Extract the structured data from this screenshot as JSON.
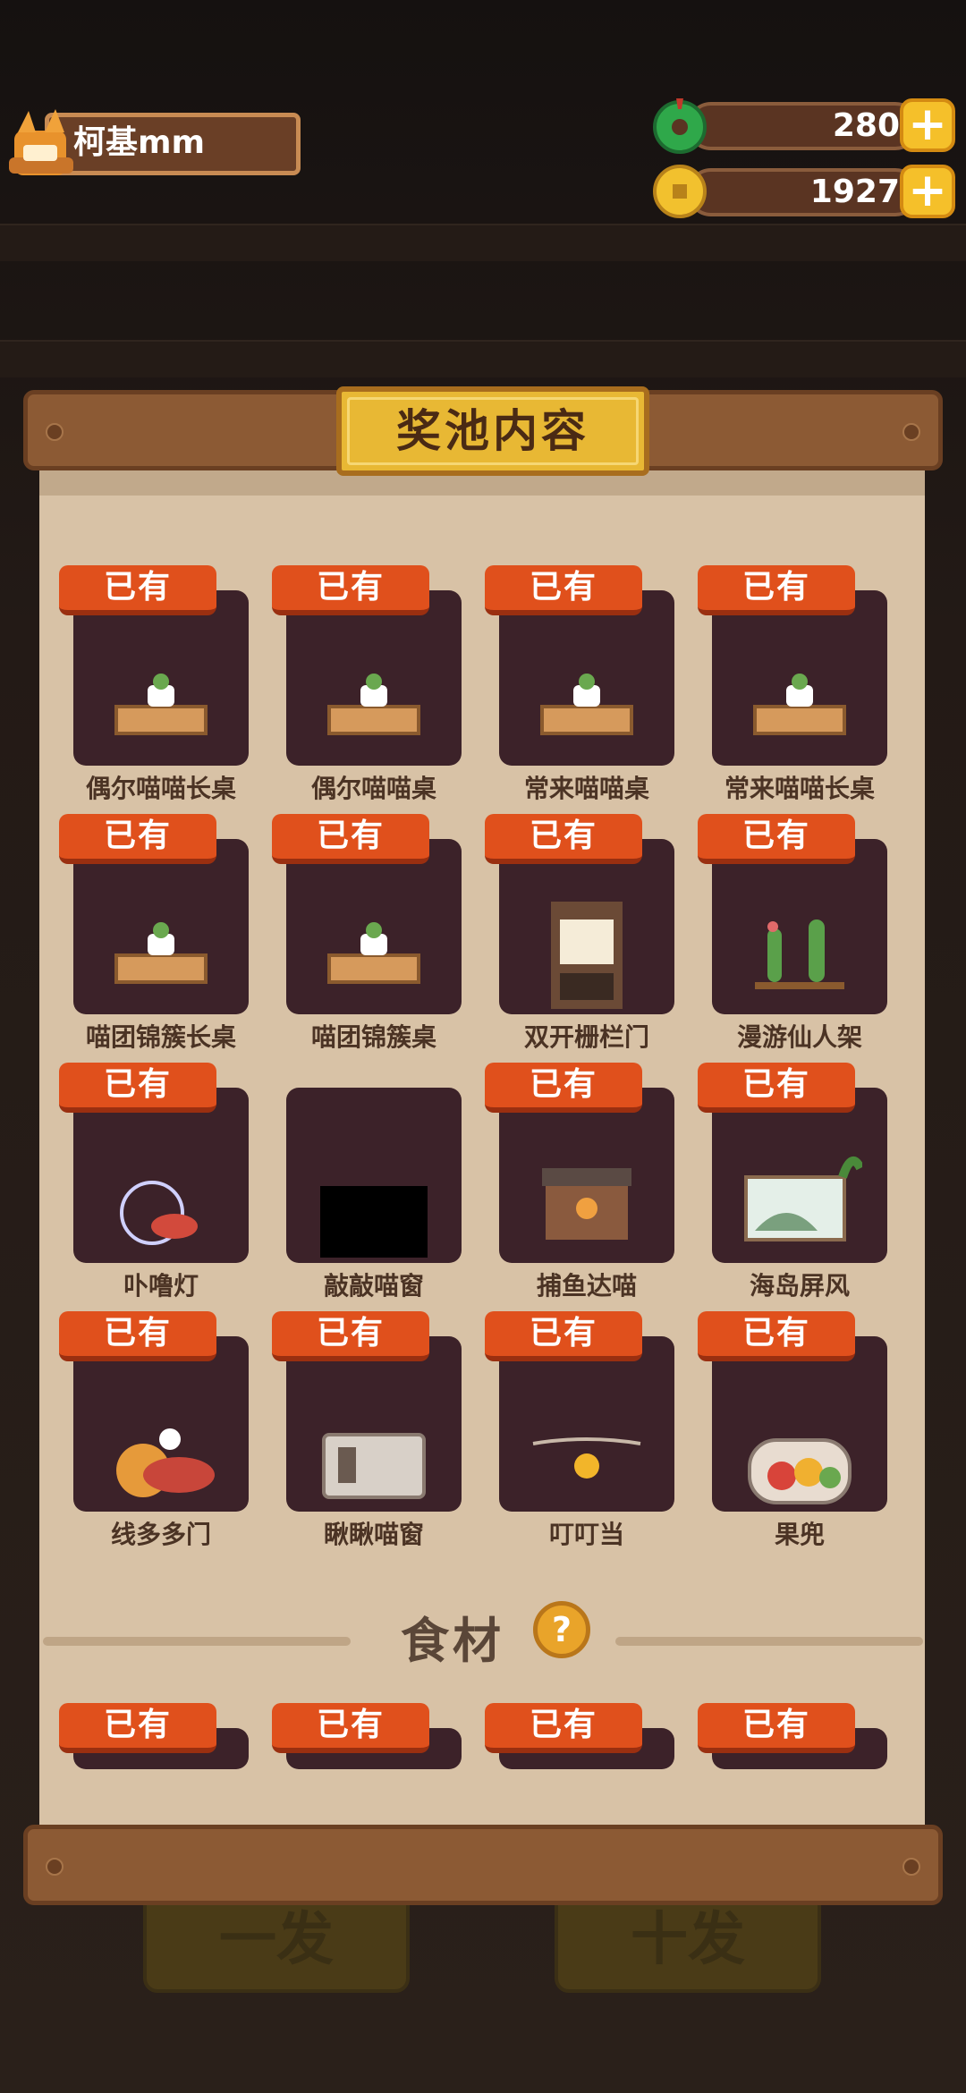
{
  "player": {
    "name": "柯基mm"
  },
  "currencies": {
    "jade": {
      "value": "280",
      "plus": "+"
    },
    "coin": {
      "value": "1927",
      "plus": "+"
    }
  },
  "modal": {
    "title": "奖池内容",
    "owned_tag": "已有",
    "items": [
      {
        "label": "偶尔喵喵长桌",
        "owned": true,
        "icon": "table-icon"
      },
      {
        "label": "偶尔喵喵桌",
        "owned": true,
        "icon": "table-icon"
      },
      {
        "label": "常来喵喵桌",
        "owned": true,
        "icon": "table-icon"
      },
      {
        "label": "常来喵喵长桌",
        "owned": true,
        "icon": "table-icon"
      },
      {
        "label": "喵团锦簇长桌",
        "owned": true,
        "icon": "table-icon"
      },
      {
        "label": "喵团锦簇桌",
        "owned": true,
        "icon": "table-icon"
      },
      {
        "label": "双开栅栏门",
        "owned": true,
        "icon": "door-icon"
      },
      {
        "label": "漫游仙人架",
        "owned": true,
        "icon": "cactus-shelf-icon"
      },
      {
        "label": "卟噜灯",
        "owned": true,
        "icon": "lamp-icon"
      },
      {
        "label": "敲敲喵窗",
        "owned": false,
        "icon": "locked-icon"
      },
      {
        "label": "捕鱼达喵",
        "owned": true,
        "icon": "stall-icon"
      },
      {
        "label": "海岛屏风",
        "owned": true,
        "icon": "screen-icon"
      },
      {
        "label": "线多多门",
        "owned": true,
        "icon": "yarn-icon"
      },
      {
        "label": "瞅瞅喵窗",
        "owned": true,
        "icon": "window-icon"
      },
      {
        "label": "叮叮当",
        "owned": true,
        "icon": "bell-icon"
      },
      {
        "label": "果兜",
        "owned": true,
        "icon": "fruit-icon"
      }
    ],
    "section": {
      "title": "食材",
      "help": "?"
    }
  },
  "background_buttons": {
    "single": "一发",
    "ten": "十发"
  }
}
